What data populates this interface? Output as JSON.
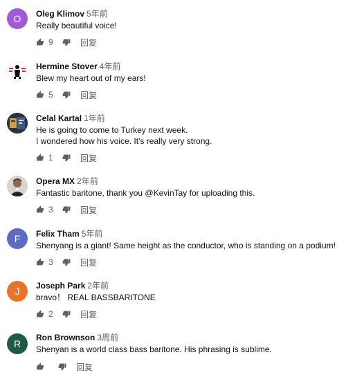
{
  "comments": [
    {
      "author": "Oleg Klimov",
      "time": "5年前",
      "lines": [
        "Really beautiful voice!"
      ],
      "likes": "9",
      "reply": "回复",
      "avatar": {
        "type": "letter",
        "letter": "O",
        "color": "#a05bd6"
      }
    },
    {
      "author": "Hermine Stover",
      "time": "4年前",
      "lines": [
        "Blew my heart out of my ears!"
      ],
      "likes": "5",
      "reply": "回复",
      "avatar": {
        "type": "image",
        "color": "#ffffff"
      }
    },
    {
      "author": "Celal Kartal",
      "time": "1年前",
      "lines": [
        "He is going to come to Turkey next week.",
        "I wondered how his voice. It's really very strong."
      ],
      "likes": "1",
      "reply": "回复",
      "avatar": {
        "type": "image",
        "color": "#2b3340"
      }
    },
    {
      "author": "Opera MX",
      "time": "2年前",
      "lines": [
        "Fantastic baritone, thank you @KevinTay for uploading this."
      ],
      "likes": "3",
      "reply": "回复",
      "avatar": {
        "type": "image",
        "color": "#d9d4cc"
      }
    },
    {
      "author": "Felix Tham",
      "time": "5年前",
      "lines": [
        "Shenyang is a giant!  Same height as the conductor, who is standing on a podium!"
      ],
      "likes": "3",
      "reply": "回复",
      "avatar": {
        "type": "letter",
        "letter": "F",
        "color": "#5c6bc0"
      }
    },
    {
      "author": "Joseph Park",
      "time": "2年前",
      "lines": [
        "bravo！ REAL BASSBARITONE"
      ],
      "likes": "2",
      "reply": "回复",
      "avatar": {
        "type": "letter",
        "letter": "J",
        "color": "#e8742c"
      }
    },
    {
      "author": "Ron Brownson",
      "time": "3周前",
      "lines": [
        "Shenyan is a world class bass baritone. His phrasing is sublime."
      ],
      "likes": "",
      "reply": "回复",
      "avatar": {
        "type": "letter",
        "letter": "R",
        "color": "#1e5b45"
      }
    }
  ],
  "icons": {
    "like": "thumbs-up-icon",
    "dislike": "thumbs-down-icon"
  },
  "colors": {
    "text": "#0f0f0f",
    "secondary": "#606060"
  }
}
